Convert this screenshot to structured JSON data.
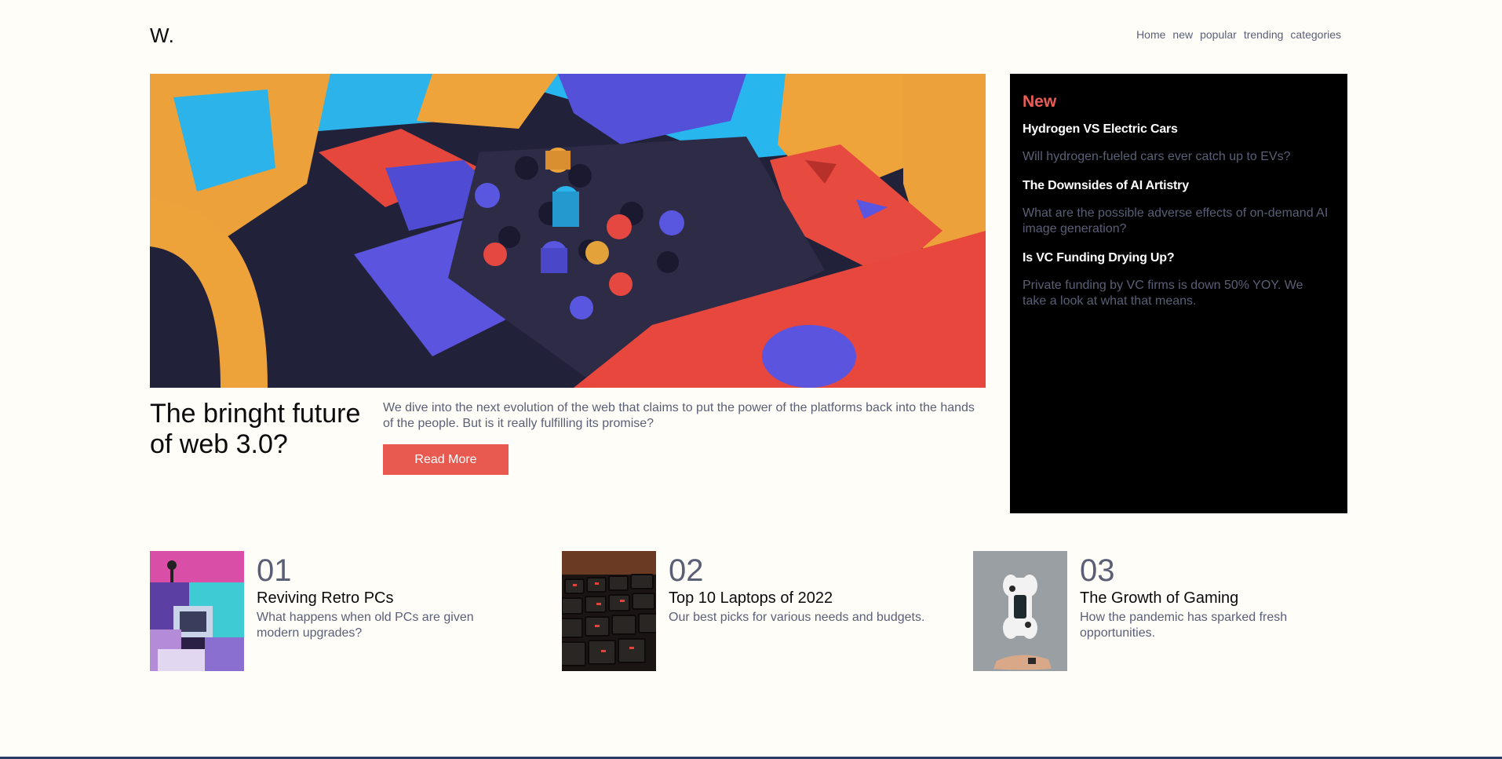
{
  "header": {
    "logo": "W.",
    "nav": [
      "Home",
      "new",
      "popular",
      "trending",
      "categories"
    ]
  },
  "hero": {
    "title": "The bringht future of web 3.0?",
    "description": "We dive into the next evolution of the web that claims to put the power of the platforms back into the hands of the people. But is it really fulfilling its promise?",
    "button_label": "Read More"
  },
  "new_panel": {
    "heading": "New",
    "items": [
      {
        "title": "Hydrogen VS Electric Cars",
        "description": "Will hydrogen-fueled cars ever catch up to EVs?"
      },
      {
        "title": "The Downsides of AI Artistry",
        "description": "What are the possible adverse effects of on-demand AI image generation?"
      },
      {
        "title": "Is VC Funding Drying Up?",
        "description": "Private funding by VC firms is down 50% YOY. We take a look at what that means."
      }
    ]
  },
  "cards": [
    {
      "number": "01",
      "title": "Reviving Retro PCs",
      "description": "What happens when old PCs are given modern upgrades?"
    },
    {
      "number": "02",
      "title": "Top 10 Laptops of 2022",
      "description": "Our best picks for various needs and budgets."
    },
    {
      "number": "03",
      "title": "The Growth of Gaming",
      "description": "How the pandemic has sparked fresh opportunities."
    }
  ],
  "colors": {
    "accent": "#e85a4f",
    "new_heading": "#ec5c56",
    "muted_text": "#5b5f76",
    "background": "#fffdf8",
    "panel_bg": "#000000"
  }
}
